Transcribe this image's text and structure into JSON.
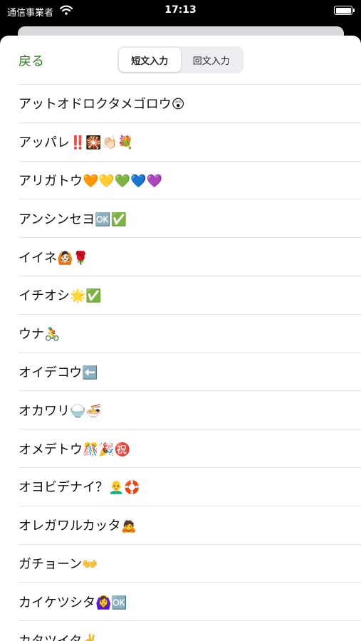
{
  "status_bar": {
    "carrier": "通信事業者",
    "time": "17:13"
  },
  "nav": {
    "back_label": "戻る",
    "segments": [
      "短文入力",
      "回文入力"
    ],
    "active_segment": 0
  },
  "phrases": [
    "アットオドロクタメゴロウ😲",
    "アッパレ‼️🎇👏🏻💐",
    "アリガトウ🧡💛💚💙💜",
    "アンシンセヨ🆗✅",
    "イイネ🙆🏻🌹",
    "イチオシ🌟✅",
    "ウナ🚴",
    "オイデコウ⬅️",
    "オカワリ🍚🍜",
    "オメデトウ🎊🎉㊗️",
    "オヨビデナイ？👨‍🦲🛟",
    "オレガワルカッタ🙇",
    "ガチョーン👐",
    "カイケツシタ🙆‍♀️🆗",
    "カタツイタ✌️"
  ]
}
